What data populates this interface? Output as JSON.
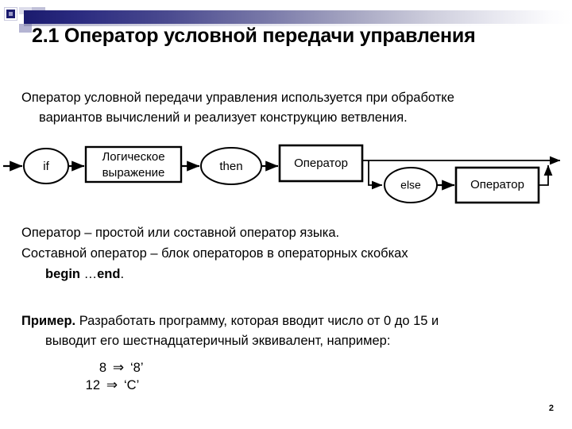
{
  "slide": {
    "title": "2.1 Оператор условной передачи управления",
    "page_number": "2"
  },
  "intro": {
    "line1": "Оператор условной передачи управления используется при обработке",
    "line2": "вариантов вычислений и реализует конструкцию ветвления."
  },
  "definitions": {
    "line1": "Оператор – простой или составной оператор языка.",
    "line2": "Составной оператор – блок операторов в операторных скобках",
    "line3_begin": "begin",
    "line3_mid": " …",
    "line3_end": "end",
    "line3_dot": "."
  },
  "example": {
    "label": "Пример.",
    "line1": " Разработать программу, которая вводит число от 0 до 15 и",
    "line2": "выводит его шестнадцатеричный эквивалент, например:"
  },
  "mappings": [
    {
      "input": "8",
      "arrow": "⇒",
      "output": "‘8’"
    },
    {
      "input": "12",
      "arrow": "⇒",
      "output": "‘C’"
    }
  ],
  "diagram": {
    "nodes": {
      "if": "if",
      "condition_line1": "Логическое",
      "condition_line2": "выражение",
      "then": "then",
      "statement_then": "Оператор",
      "else": "else",
      "statement_else": "Оператор"
    },
    "stroke_color": "#000000"
  }
}
